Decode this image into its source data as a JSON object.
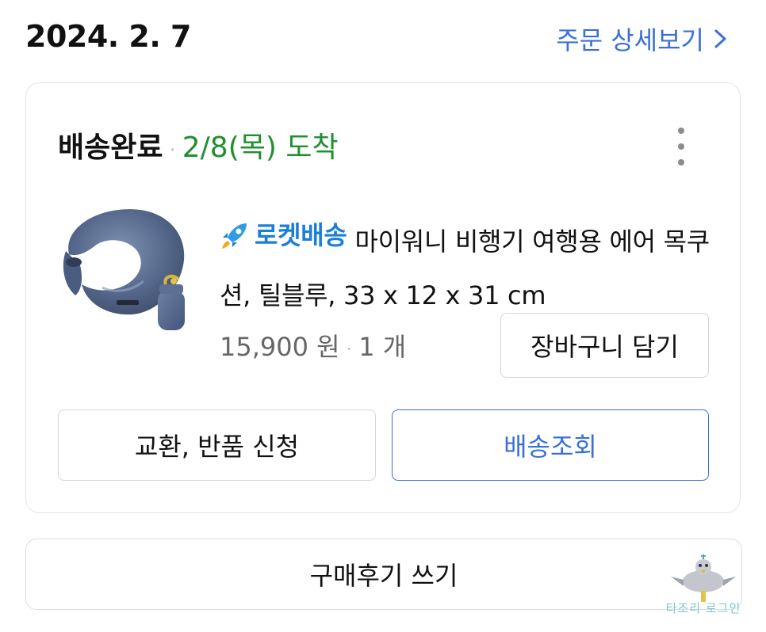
{
  "order": {
    "date": "2024. 2. 7",
    "detail_link_label": "주문 상세보기"
  },
  "shipment": {
    "status": "배송완료",
    "separator": "·",
    "arrival": "2/8(목) 도착"
  },
  "product": {
    "badge": "로켓배송",
    "title": "마이워니 비행기 여행용 에어 목쿠션, 틸블루, 33 x 12 x 31 cm",
    "price": "15,900 원",
    "separator": "·",
    "quantity": "1 개",
    "image_icon": "neck-pillow-image"
  },
  "buttons": {
    "add_to_cart": "장바구니 담기",
    "exchange_return": "교환, 반품 신청",
    "track_delivery": "배송조회",
    "write_review": "구매후기 쓰기"
  },
  "watermark": {
    "text": "타조리 로그인"
  },
  "colors": {
    "accent_blue": "#3a6fd9",
    "rocket_blue": "#1b7fd8",
    "arrival_green": "#1f8f2f",
    "border_gray": "#e3e3e6"
  }
}
